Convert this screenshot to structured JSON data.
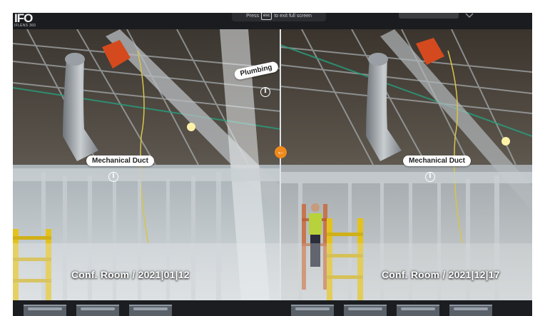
{
  "logo": {
    "text": "IFO",
    "subtext": "IFLENS 360"
  },
  "banner": {
    "prefix": "Press",
    "key": "esc",
    "suffix": "to exit full screen"
  },
  "left": {
    "caption": "Conf. Room / 2021|01|12",
    "tags": {
      "duct": "Mechanical Duct",
      "plumbing": "Plumbing"
    }
  },
  "right": {
    "caption": "Conf. Room / 2021|12|17",
    "tags": {
      "duct": "Mechanical Duct"
    }
  },
  "icons": {
    "info": "info-icon",
    "swap": "arrow-left-icon"
  },
  "colors": {
    "accent": "#f08a1c",
    "background": "#1b1d21"
  },
  "thumbnails": [
    {},
    {},
    {},
    {},
    {},
    {},
    {},
    {},
    {}
  ]
}
